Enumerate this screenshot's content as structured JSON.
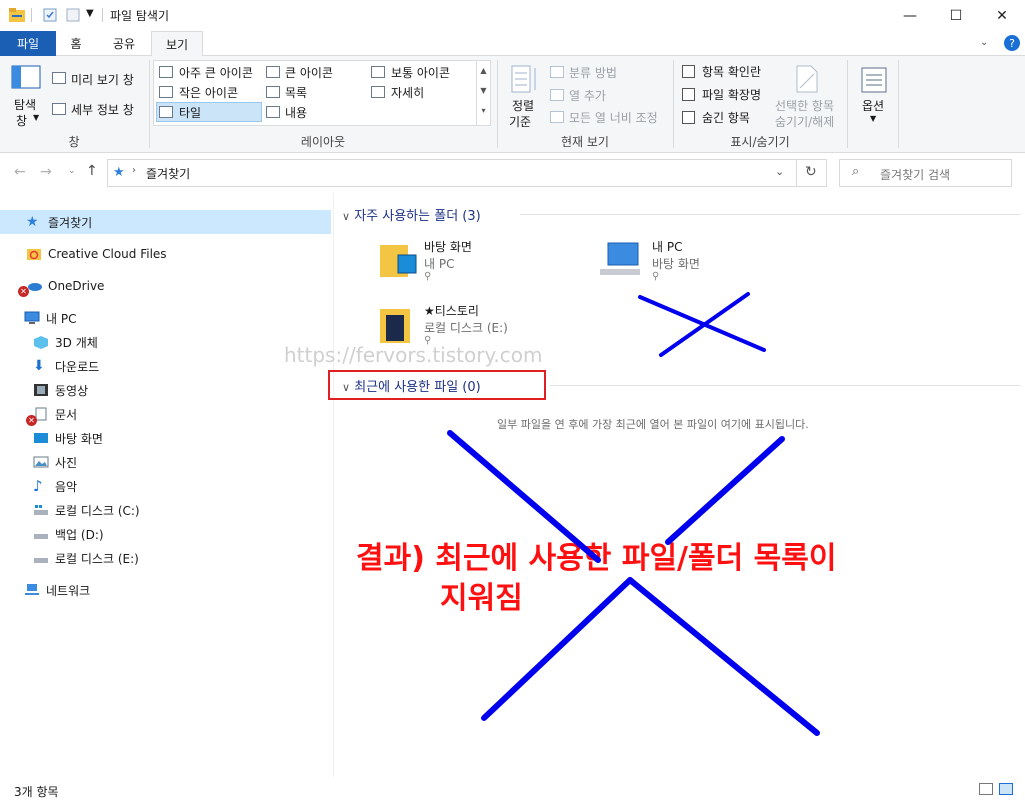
{
  "window": {
    "title": "파일 탐색기",
    "controls": {
      "minimize": "—",
      "maximize": "☐",
      "close": "✕"
    }
  },
  "tabs": {
    "file": "파일",
    "home": "홈",
    "share": "공유",
    "view": "보기"
  },
  "ribbon": {
    "pane": {
      "nav_label_1": "탐색",
      "nav_label_2": "창",
      "preview": "미리 보기 창",
      "details": "세부 정보 창",
      "group": "창"
    },
    "layout": {
      "extra_large": "아주 큰 아이콘",
      "large": "큰 아이콘",
      "medium": "보통 아이콘",
      "small": "작은 아이콘",
      "list": "목록",
      "details": "자세히",
      "tiles": "타일",
      "content": "내용",
      "group": "레이아웃",
      "selected": "타일"
    },
    "current_view": {
      "sort_1": "정렬",
      "sort_2": "기준",
      "group_by": "분류 방법",
      "add_columns": "열 추가",
      "size_all": "모든 열 너비 조정",
      "group": "현재 보기"
    },
    "show_hide": {
      "item_checkboxes": "항목 확인란",
      "file_extensions": "파일 확장명",
      "hidden_items": "숨긴 항목",
      "hide_selected_1": "선택한 항목",
      "hide_selected_2": "숨기기/해제",
      "group": "표시/숨기기"
    },
    "options": {
      "label": "옵션"
    }
  },
  "address": {
    "path": "즐겨찾기",
    "search_placeholder": "즐겨찾기 검색"
  },
  "nav_pane": [
    {
      "label": "즐겨찾기",
      "icon": "star-icon",
      "selected": true
    },
    {
      "label": "Creative Cloud Files",
      "icon": "creative-cloud-icon"
    },
    {
      "label": "OneDrive",
      "icon": "onedrive-icon"
    },
    {
      "label": "내 PC",
      "icon": "pc-icon"
    },
    {
      "label": "3D 개체",
      "icon": "3d-objects-icon"
    },
    {
      "label": "다운로드",
      "icon": "download-icon"
    },
    {
      "label": "동영상",
      "icon": "video-icon"
    },
    {
      "label": "문서",
      "icon": "documents-icon"
    },
    {
      "label": "바탕 화면",
      "icon": "desktop-icon"
    },
    {
      "label": "사진",
      "icon": "pictures-icon"
    },
    {
      "label": "음악",
      "icon": "music-icon"
    },
    {
      "label": "로컬 디스크 (C:)",
      "icon": "drive-icon"
    },
    {
      "label": "백업 (D:)",
      "icon": "drive-icon"
    },
    {
      "label": "로컬 디스크 (E:)",
      "icon": "drive-icon"
    },
    {
      "label": "네트워크",
      "icon": "network-icon"
    }
  ],
  "frequent": {
    "header": "자주 사용하는 폴더 (3)",
    "items": [
      {
        "name": "바탕 화면",
        "location": "내 PC"
      },
      {
        "name": "내 PC",
        "location": "바탕 화면"
      },
      {
        "name": "★티스토리",
        "location": "로컬 디스크 (E:)"
      }
    ]
  },
  "recent": {
    "header": "최근에 사용한 파일 (0)",
    "empty_message": "일부 파일을 연 후에 가장 최근에 열어 본 파일이 여기에 표시됩니다."
  },
  "watermark": "https://fervors.tistory.com",
  "annotation": {
    "line1": "결과) 최근에 사용한 파일/폴더 목록이",
    "line2": "지워짐",
    "color": "#ff1010",
    "mark_color": "#0000ee"
  },
  "status": {
    "item_count": "3개 항목"
  }
}
